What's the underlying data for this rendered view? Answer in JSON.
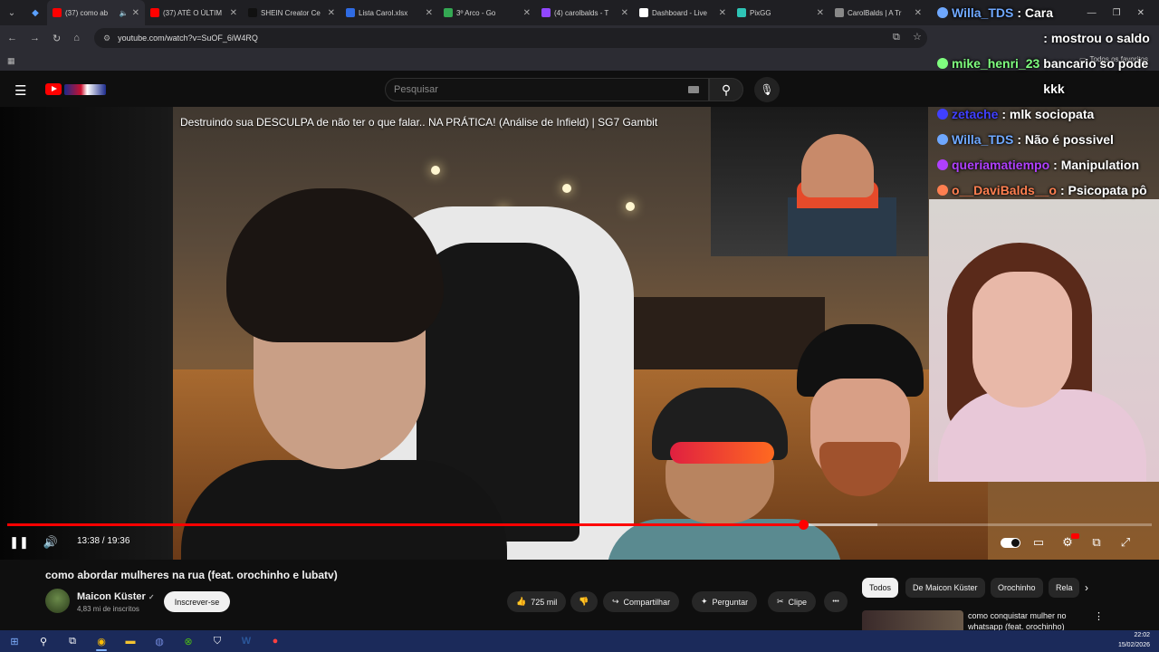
{
  "browser": {
    "tabs": [
      {
        "title": "(37) como ab",
        "color": "#ff0000",
        "active": true,
        "muted": true
      },
      {
        "title": "(37) ATÉ O ÚLTIM",
        "color": "#ff0000",
        "active": false
      },
      {
        "title": "SHEIN Creator Ce",
        "color": "#111111",
        "active": false,
        "glyph": "S"
      },
      {
        "title": "Lista Carol.xlsx",
        "color": "#2f6be3",
        "active": false
      },
      {
        "title": "3º Arco - Go",
        "color": "#34a853",
        "active": false
      },
      {
        "title": "(4) carolbalds - T",
        "color": "#9147ff",
        "active": false
      },
      {
        "title": "Dashboard - Live",
        "color": "#ffffff",
        "active": false
      },
      {
        "title": "PixGG",
        "color": "#2ec4b6",
        "active": false
      },
      {
        "title": "CarolBalds | A Tr",
        "color": "#888888",
        "active": false
      }
    ],
    "url": "youtube.com/watch?v=SuOF_6iW4RQ",
    "bookmarks_right": "Todos os favoritos"
  },
  "youtube": {
    "search_placeholder": "Pesquisar",
    "video": {
      "overlay_title": "Destruindo sua DESCULPA de não ter o que falar.. NA PRÁTICA! (Análise de Infield) | SG7 Gambit",
      "time_current": "13:38",
      "time_total": "19:36",
      "time_display": "13:38 / 19:36",
      "played_fraction": 0.6956,
      "buffered_fraction": 0.76
    },
    "title": "como abordar mulheres na rua (feat. orochinho e lubatv)",
    "channel": {
      "name": "Maicon Küster",
      "verified": "✓",
      "subscribers": "4,83 mi de inscritos",
      "subscribe_label": "Inscrever-se"
    },
    "actions": {
      "likes": "725 mil",
      "share": "Compartilhar",
      "ask": "Perguntar",
      "clip": "Clipe",
      "more": "•••"
    },
    "chips": [
      "Todos",
      "De Maicon Küster",
      "Orochinho",
      "Rela"
    ],
    "recommendation_title": "como conquistar mulher no whatsapp (feat. orochinho)"
  },
  "chat": [
    {
      "user": "Willa_TDS",
      "user_color": "#6fa8ff",
      "message": ": Cara"
    },
    {
      "user": "mike_henri_23",
      "user_color": "#7fff7f",
      "message": ": mostrou o saldo bancario so pode kkk"
    },
    {
      "user": "zetache",
      "user_color": "#4040ff",
      "message": ": mlk sociopata"
    },
    {
      "user": "Willa_TDS",
      "user_color": "#6fa8ff",
      "message": ": Não é possivel"
    },
    {
      "user": "queriamatiempo",
      "user_color": "#b040ff",
      "message": ": Manipulation"
    },
    {
      "user": "o__DaviBalds__o",
      "user_color": "#ff7f50",
      "message": ": Psicopata pô"
    }
  ],
  "taskbar": {
    "time": "22:02",
    "date": "15/02/2026"
  }
}
